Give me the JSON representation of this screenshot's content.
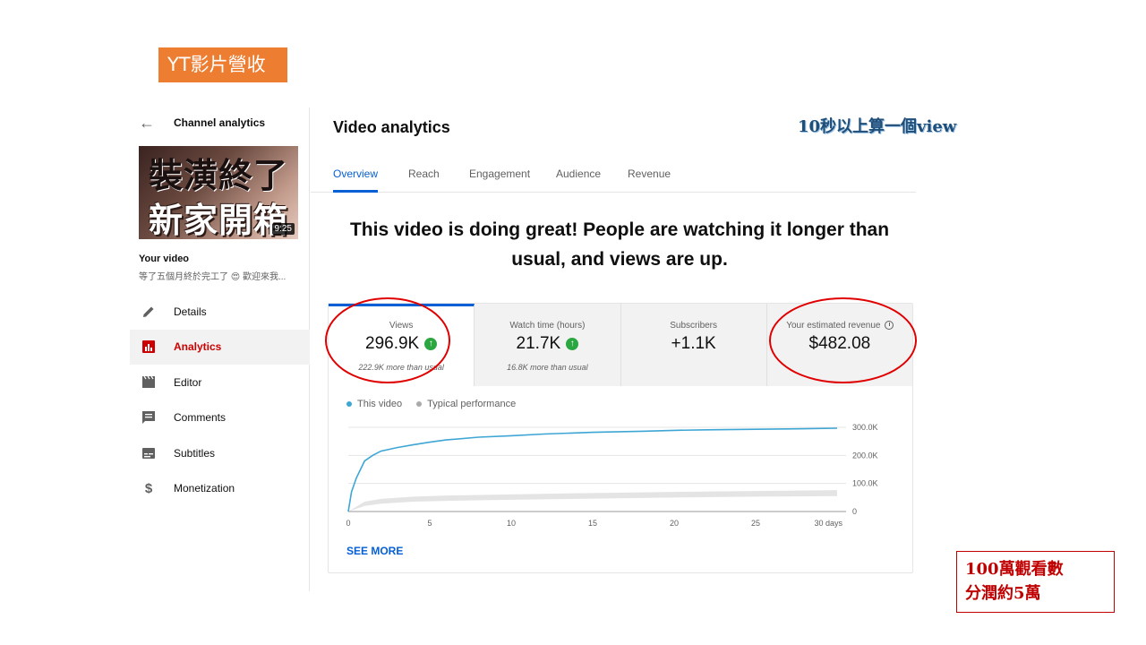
{
  "slide": {
    "title": "YT影片營收",
    "annotation_views": "10秒以上算一個view",
    "annotation_revenue_line1": "100萬觀看數",
    "annotation_revenue_line2": "分潤約5萬"
  },
  "sidebar": {
    "back_label": "Channel analytics",
    "thumbnail_line1": "裝潢終了",
    "thumbnail_line2": "新家開箱",
    "thumbnail_duration": "9:25",
    "your_video_label": "Your video",
    "video_description": "等了五個月終於完工了 😍 歡迎來我...",
    "items": [
      {
        "label": "Details",
        "icon": "pencil-icon"
      },
      {
        "label": "Analytics",
        "icon": "analytics-icon"
      },
      {
        "label": "Editor",
        "icon": "clapper-icon"
      },
      {
        "label": "Comments",
        "icon": "comment-icon"
      },
      {
        "label": "Subtitles",
        "icon": "subtitles-icon"
      },
      {
        "label": "Monetization",
        "icon": "dollar-icon"
      }
    ],
    "active_item": "Analytics"
  },
  "main": {
    "title": "Video analytics",
    "tabs": [
      "Overview",
      "Reach",
      "Engagement",
      "Audience",
      "Revenue"
    ],
    "active_tab": "Overview",
    "headline": "This video is doing great! People are watching it longer than usual, and views are up."
  },
  "metrics": [
    {
      "label": "Views",
      "value": "296.9K",
      "sub": "222.9K more than usual"
    },
    {
      "label": "Watch time (hours)",
      "value": "21.7K",
      "sub": "16.8K more than usual"
    },
    {
      "label": "Subscribers",
      "value": "+1.1K",
      "sub": ""
    },
    {
      "label": "Your estimated revenue",
      "value": "$482.08",
      "sub": ""
    }
  ],
  "chart_legend": {
    "this_video": "This video",
    "typical": "Typical performance"
  },
  "see_more": "SEE MORE",
  "colors": {
    "accent": "#065fd4",
    "series_this_video": "#3ea6d5",
    "band_typical": "#e4e4e4",
    "up_green": "#2ba640",
    "active_nav": "#cc0000",
    "title_orange": "#ed7d31",
    "annotation_red": "#e00000"
  },
  "chart_data": {
    "type": "line",
    "x_ticks": [
      "0",
      "5",
      "10",
      "15",
      "20",
      "25",
      "30 days"
    ],
    "y_ticks": [
      "0",
      "100.0K",
      "200.0K",
      "300.0K"
    ],
    "ylim": [
      0,
      300000
    ],
    "xlim": [
      0,
      30
    ],
    "series": [
      {
        "name": "This video",
        "x": [
          0,
          0.2,
          0.5,
          1,
          1.5,
          2,
          3,
          4,
          5,
          6,
          8,
          10,
          12,
          15,
          18,
          20,
          22,
          25,
          28,
          30
        ],
        "y": [
          0,
          70000,
          120000,
          180000,
          200000,
          215000,
          228000,
          238000,
          247000,
          255000,
          265000,
          270000,
          276000,
          282000,
          286000,
          289000,
          291000,
          293000,
          295000,
          296900
        ]
      }
    ],
    "typical_band": {
      "x": [
        0,
        1,
        2,
        4,
        6,
        10,
        15,
        20,
        25,
        30
      ],
      "low": [
        0,
        20000,
        28000,
        35000,
        38000,
        42000,
        46000,
        50000,
        53000,
        55000
      ],
      "high": [
        0,
        35000,
        45000,
        53000,
        57000,
        61000,
        66000,
        70000,
        73000,
        76000
      ]
    },
    "grid": true,
    "legend": "top-left"
  }
}
